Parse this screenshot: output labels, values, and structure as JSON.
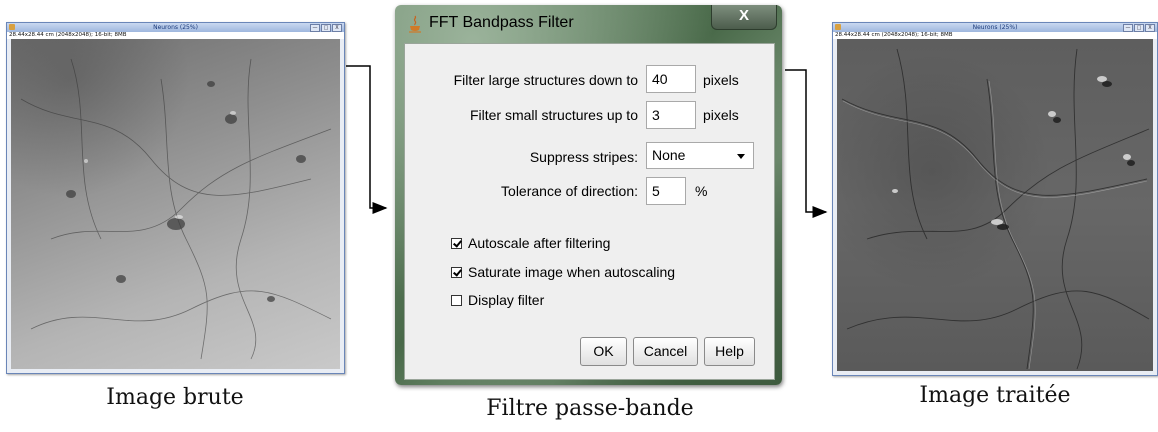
{
  "left_window": {
    "title": "Neurons (25%)",
    "info": "28.44x28.44 cm (2048x2048); 16-bit; 8MB",
    "ctrl_min": "—",
    "ctrl_max": "□",
    "ctrl_close": "X"
  },
  "right_window": {
    "title": "Neurons (25%)",
    "info": "28.44x28.44 cm (2048x2048); 16-bit; 8MB",
    "ctrl_min": "—",
    "ctrl_max": "□",
    "ctrl_close": "X"
  },
  "dialog": {
    "title": "FFT Bandpass Filter",
    "close_label": "X",
    "filter_large_label": "Filter large structures down to",
    "filter_large_value": "40",
    "filter_large_unit": "pixels",
    "filter_small_label": "Filter small structures up to",
    "filter_small_value": "3",
    "filter_small_unit": "pixels",
    "suppress_label": "Suppress stripes:",
    "suppress_value": "None",
    "tolerance_label": "Tolerance of direction:",
    "tolerance_value": "5",
    "tolerance_unit": "%",
    "checkboxes": [
      {
        "label": "Autoscale after filtering",
        "checked": true
      },
      {
        "label": "Saturate image when autoscaling",
        "checked": true
      },
      {
        "label": "Display filter",
        "checked": false
      }
    ],
    "ok_label": "OK",
    "cancel_label": "Cancel",
    "help_label": "Help"
  },
  "captions": {
    "raw": "Image brute",
    "filter": "Filtre passe-bande",
    "processed": "Image traitée"
  },
  "colors": {
    "arrow": "#000000",
    "dialog_client": "#efefef"
  }
}
